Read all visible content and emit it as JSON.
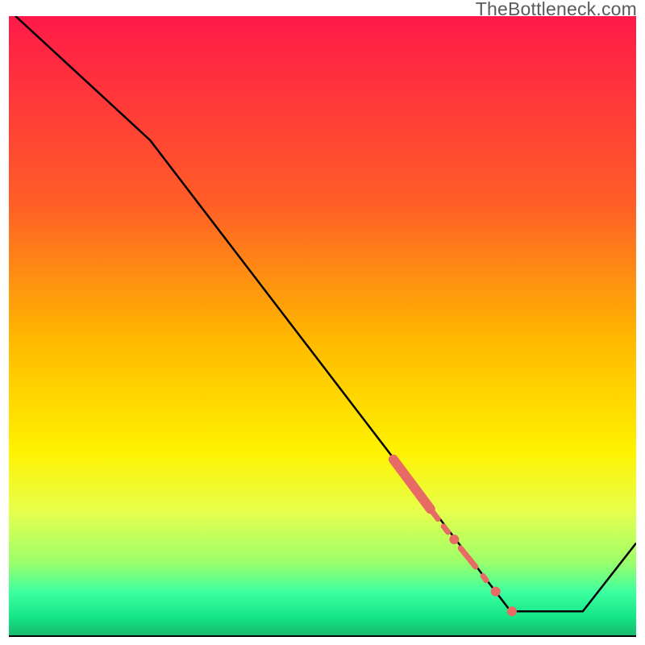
{
  "watermark": "TheBottleneck.com",
  "chart_data": {
    "type": "line",
    "title": "",
    "xlabel": "",
    "ylabel": "",
    "xlim": [
      0,
      100
    ],
    "ylim": [
      0,
      100
    ],
    "background_gradient_stops": [
      {
        "offset": 0.0,
        "color": "#ff1a49"
      },
      {
        "offset": 0.3,
        "color": "#ff5d27"
      },
      {
        "offset": 0.52,
        "color": "#ffb800"
      },
      {
        "offset": 0.7,
        "color": "#fff200"
      },
      {
        "offset": 0.8,
        "color": "#e6ff4d"
      },
      {
        "offset": 0.88,
        "color": "#9dff6a"
      },
      {
        "offset": 0.93,
        "color": "#3bffa0"
      },
      {
        "offset": 0.97,
        "color": "#14e585"
      },
      {
        "offset": 1.0,
        "color": "#19b76a"
      }
    ],
    "series": [
      {
        "name": "bottleneck-curve",
        "type": "line",
        "color": "#000000",
        "width": 2.5,
        "points": [
          {
            "x": 0.0,
            "y": 101.0
          },
          {
            "x": 22.5,
            "y": 80.0
          },
          {
            "x": 80.0,
            "y": 4.0
          },
          {
            "x": 91.5,
            "y": 4.0
          },
          {
            "x": 100.0,
            "y": 15.0
          }
        ]
      },
      {
        "name": "highlighted-segments",
        "type": "thick-line",
        "color": "#e86a64",
        "width_thick": 12,
        "width_thin": 7,
        "segments": [
          {
            "x1": 61.3,
            "y1": 28.5,
            "x2": 67.2,
            "y2": 20.5,
            "w": 12
          },
          {
            "x1": 67.2,
            "y1": 20.5,
            "x2": 68.4,
            "y2": 18.9,
            "w": 7
          },
          {
            "x1": 69.3,
            "y1": 17.7,
            "x2": 70.0,
            "y2": 16.8,
            "w": 7
          },
          {
            "x1": 72.0,
            "y1": 14.2,
            "x2": 74.4,
            "y2": 11.2,
            "w": 7
          },
          {
            "x1": 75.6,
            "y1": 9.7,
            "x2": 76.1,
            "y2": 9.0,
            "w": 7
          }
        ]
      },
      {
        "name": "highlighted-dots",
        "type": "scatter",
        "color": "#e86a64",
        "radius": 6.0,
        "points": [
          {
            "x": 71.0,
            "y": 15.6
          },
          {
            "x": 77.6,
            "y": 7.2
          },
          {
            "x": 80.2,
            "y": 4.0
          }
        ]
      }
    ]
  }
}
